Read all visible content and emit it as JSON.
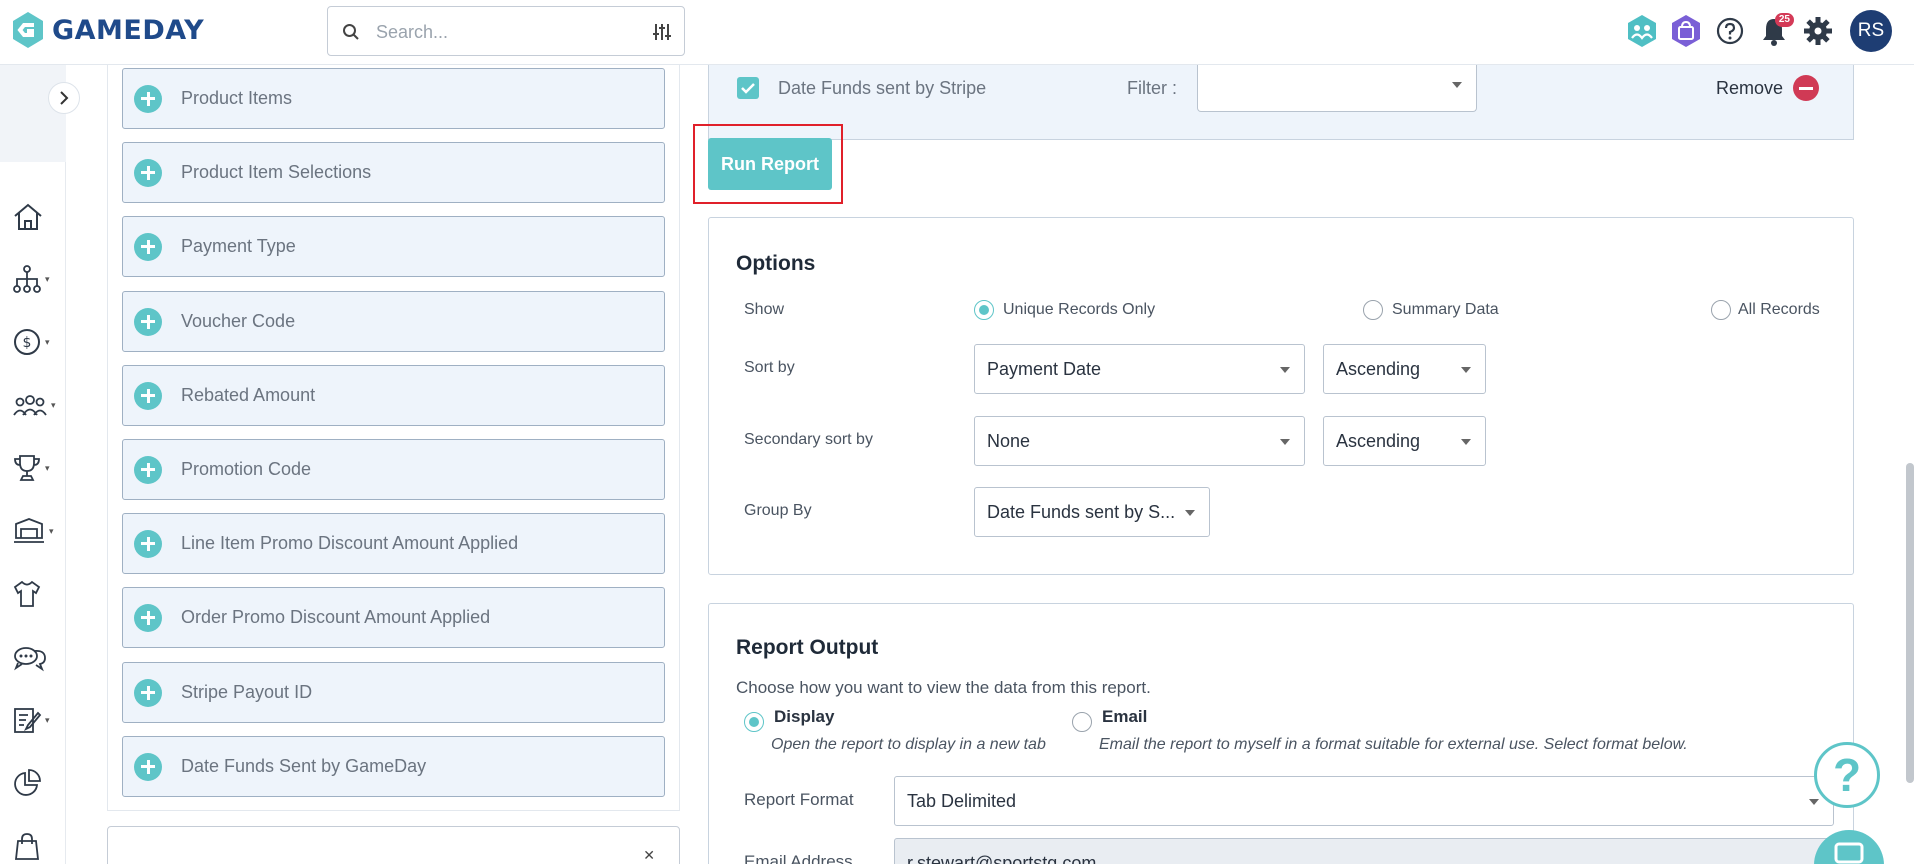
{
  "header": {
    "logo_text": "GAMEDAY",
    "search_placeholder": "Search...",
    "notification_count": "25",
    "avatar_initials": "RS"
  },
  "left_fields": [
    {
      "label": "Product Items"
    },
    {
      "label": "Product Item Selections"
    },
    {
      "label": "Payment Type"
    },
    {
      "label": "Voucher Code"
    },
    {
      "label": "Rebated Amount"
    },
    {
      "label": "Promotion Code"
    },
    {
      "label": "Line Item Promo Discount Amount Applied"
    },
    {
      "label": "Order Promo Discount Amount Applied"
    },
    {
      "label": "Stripe Payout ID"
    },
    {
      "label": "Date Funds Sent by GameDay"
    }
  ],
  "filter_row": {
    "field_name": "Date Funds sent by Stripe",
    "filter_label": "Filter :",
    "filter_value": "",
    "remove_label": "Remove"
  },
  "run_report_label": "Run Report",
  "options": {
    "title": "Options",
    "show_label": "Show",
    "show_options": [
      {
        "label": "Unique Records Only",
        "selected": true
      },
      {
        "label": "Summary Data",
        "selected": false
      },
      {
        "label": "All Records",
        "selected": false
      }
    ],
    "sort_by_label": "Sort by",
    "sort_by_value": "Payment Date",
    "sort_by_order": "Ascending",
    "secondary_sort_label": "Secondary sort by",
    "secondary_sort_value": "None",
    "secondary_sort_order": "Ascending",
    "group_by_label": "Group By",
    "group_by_value": "Date Funds sent by S..."
  },
  "report_output": {
    "title": "Report Output",
    "description": "Choose how you want to view the data from this report.",
    "display_title": "Display",
    "display_desc": "Open the report to display in a new tab",
    "email_title": "Email",
    "email_desc": "Email the report to myself in a format suitable for external use. Select format below.",
    "format_label": "Report Format",
    "format_value": "Tab Delimited",
    "email_address_label": "Email Address",
    "email_address_value": "r.stewart@sportstg.com"
  },
  "colors": {
    "accent": "#5ec5c8",
    "brand": "#1f4a8a",
    "danger": "#d03a55",
    "highlight": "#e0202a"
  }
}
